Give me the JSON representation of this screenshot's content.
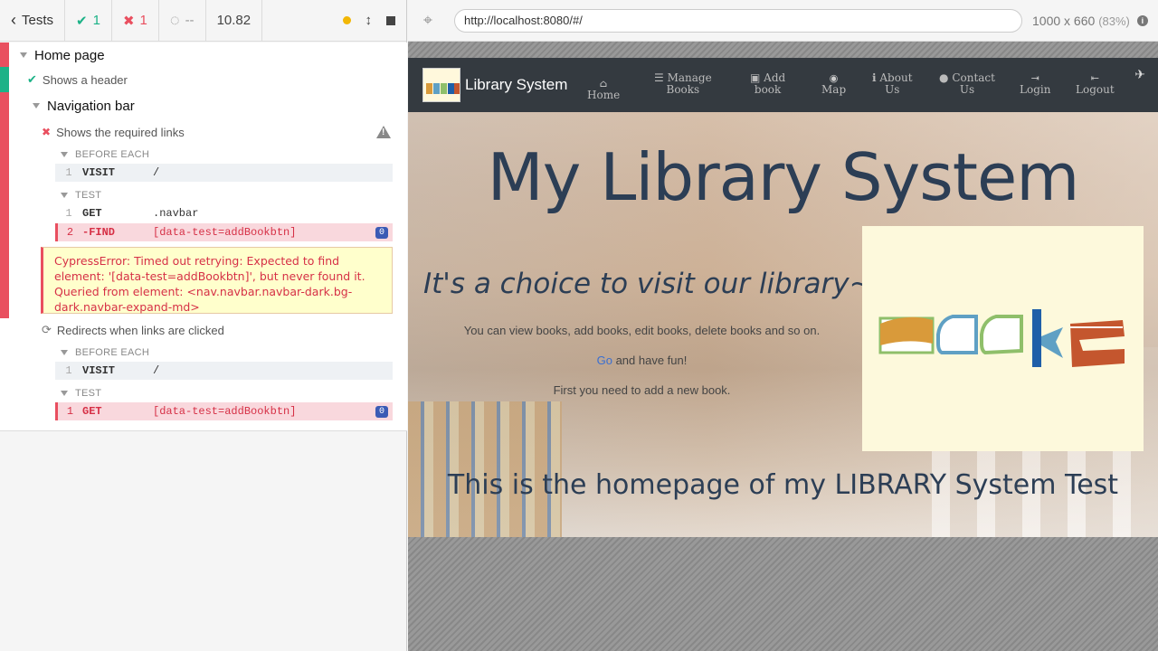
{
  "reporter": {
    "tests_label": "Tests",
    "passed": "1",
    "failed": "1",
    "pending": "--",
    "duration": "10.82"
  },
  "suite": {
    "title": "Home page",
    "test1": "Shows a header",
    "nav_suite": "Navigation bar",
    "test2": "Shows the required links",
    "before_each": "BEFORE EACH",
    "test_label": "TEST",
    "t2_cmds": [
      {
        "num": "1",
        "name": "VISIT",
        "msg": "/"
      },
      {
        "num": "1",
        "name": "GET",
        "msg": ".navbar"
      },
      {
        "num": "2",
        "name": "-FIND",
        "msg": "[data-test=addBookbtn]",
        "badge": "0"
      }
    ],
    "error": "CypressError: Timed out retrying: Expected to find element: '[data-test=addBookbtn]', but never found it. Queried from element: <nav.navbar.navbar-dark.bg-dark.navbar-expand-md>",
    "test3": "Redirects when links are clicked",
    "t3_cmds": [
      {
        "num": "1",
        "name": "VISIT",
        "msg": "/"
      },
      {
        "num": "1",
        "name": "GET",
        "msg": "[data-test=addBookbtn]",
        "badge": "0"
      }
    ]
  },
  "aut": {
    "url": "http://localhost:8080/#/",
    "viewport": "1000 x 660",
    "scale": "(83%)"
  },
  "site": {
    "brand": "Library System",
    "nav": [
      {
        "line1": "Home",
        "line2": "",
        "icon": "home-icon"
      },
      {
        "line1": "Manage",
        "line2": "Books",
        "icon": "list-icon"
      },
      {
        "line1": "Add",
        "line2": "book",
        "icon": "camera-icon"
      },
      {
        "line1": "",
        "line2": "Map",
        "icon": "globe-icon"
      },
      {
        "line1": "About",
        "line2": "Us",
        "icon": "info-icon"
      },
      {
        "line1": "Contact",
        "line2": "Us",
        "icon": "comment-icon"
      },
      {
        "line1": "",
        "line2": "Login",
        "icon": "login-icon"
      },
      {
        "line1": "",
        "line2": "Logout",
        "icon": "logout-icon"
      }
    ],
    "hero_title": "My Library System",
    "choice": "It's a choice to visit our library~~",
    "para1": "You can view books, add books, edit books, delete books and so on.",
    "go_link": "Go",
    "para2_rest": " and have fun!",
    "para3": "First you need to add a new book.",
    "footer": "This is the homepage of my LIBRARY System Test"
  },
  "colors": {
    "pass": "#1cb287",
    "fail": "#e94f5f",
    "navbar": "#343a40",
    "heading": "#2c3e55"
  }
}
